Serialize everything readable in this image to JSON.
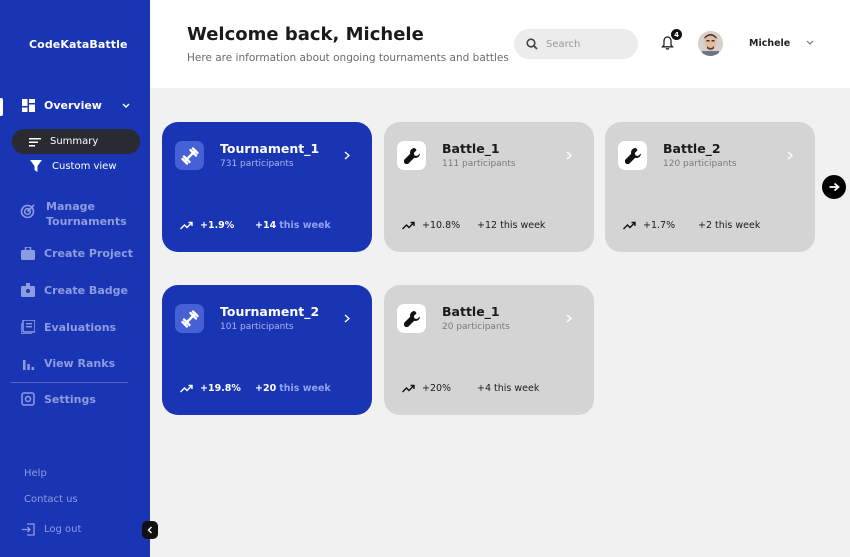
{
  "app": {
    "name": "CodeKataBattle"
  },
  "sidebar": {
    "overview": {
      "label": "Overview",
      "icon": "grid-icon"
    },
    "summary": {
      "label": "Summary",
      "icon": "lines-icon"
    },
    "custom_view": {
      "label": "Custom view",
      "icon": "filter-icon"
    },
    "items": [
      {
        "label_line1": "Manage",
        "label_line2": "Tournaments",
        "icon": "target-icon"
      },
      {
        "label": "Create Project",
        "icon": "briefcase-icon"
      },
      {
        "label": "Create Badge",
        "icon": "badge-icon"
      },
      {
        "label": "Evaluations",
        "icon": "list-icon"
      },
      {
        "label": "View Ranks",
        "icon": "bar-chart-icon"
      },
      {
        "label": "Settings",
        "icon": "gear-icon"
      }
    ],
    "help": "Help",
    "contact": "Contact us",
    "logout": "Log out"
  },
  "header": {
    "welcome": "Welcome back, Michele",
    "subtitle": "Here are information about ongoing tournaments and battles",
    "search_placeholder": "Search",
    "notification_count": "4",
    "username": "Michele"
  },
  "cards": [
    {
      "title": "Tournament_1",
      "participants": "731 participants",
      "pct": "+1.9%",
      "week_num": "+14",
      "week_text": "this week",
      "style": "blue"
    },
    {
      "title": "Battle_1",
      "participants": "111 participants",
      "pct": "+10.8%",
      "week_num": "+12",
      "week_text": "this week",
      "style": "gray"
    },
    {
      "title": "Battle_2",
      "participants": "120 participants",
      "pct": "+1.7%",
      "week_num": "+2",
      "week_text": "this week",
      "style": "gray"
    },
    {
      "title": "Tournament_2",
      "participants": "101 participants",
      "pct": "+19.8%",
      "week_num": "+20",
      "week_text": "this week",
      "style": "blue"
    },
    {
      "title": "Battle_1",
      "participants": "20 participants",
      "pct": "+20%",
      "week_num": "+4",
      "week_text": "this week",
      "style": "gray"
    }
  ],
  "colors": {
    "primary": "#1a35b4",
    "card_gray": "#d4d4d4",
    "background": "#f1f1f1"
  }
}
